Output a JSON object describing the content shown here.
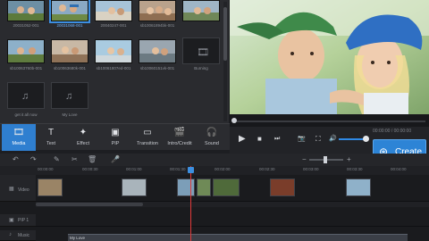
{
  "library": {
    "row1": [
      {
        "caption": "20031052-001",
        "selected": false
      },
      {
        "caption": "20031068-001",
        "selected": true
      },
      {
        "caption": "20040247-001",
        "selected": false
      },
      {
        "caption": "sb10061894bk-001",
        "selected": false
      }
    ],
    "row2": [
      {
        "caption": "sb10063760b-001",
        "selected": false
      },
      {
        "caption": "sb10063680k-001",
        "selected": false
      },
      {
        "caption": "sb10061807ed-001",
        "selected": false
      },
      {
        "caption": "sb10060151vk-001",
        "selected": false
      },
      {
        "caption": "Burning",
        "selected": false
      }
    ],
    "row3": [
      {
        "caption": "get it all now",
        "icon": "music-note-icon"
      },
      {
        "caption": "My Love",
        "icon": "music-note-icon"
      }
    ]
  },
  "preview": {
    "time": "00:00:00 / 00:00:00",
    "controls": {
      "play": "▶",
      "stop": "■",
      "next_frame": "⏭",
      "snapshot": "📷",
      "fullscreen": "⛶",
      "volume": "🔊"
    }
  },
  "create_button": {
    "label": "Create",
    "icon": "film-reel-icon"
  },
  "tabs": [
    {
      "label": "Media",
      "icon": "media-icon",
      "glyph": "🎞",
      "active": true
    },
    {
      "label": "Text",
      "icon": "text-icon",
      "glyph": "T",
      "active": false
    },
    {
      "label": "Effect",
      "icon": "effect-icon",
      "glyph": "✦",
      "active": false
    },
    {
      "label": "PIP",
      "icon": "pip-icon",
      "glyph": "▣",
      "active": false
    },
    {
      "label": "Transition",
      "icon": "transition-icon",
      "glyph": "▭",
      "active": false
    },
    {
      "label": "Intro/Credit",
      "icon": "intro-credit-icon",
      "glyph": "🎬",
      "active": false
    },
    {
      "label": "Sound",
      "icon": "sound-icon",
      "glyph": "🎧",
      "active": false
    }
  ],
  "timeline": {
    "ruler_labels": [
      "00:00:00",
      "00:00:30",
      "00:01:00",
      "00:01:30",
      "00:02:00",
      "00:02:30",
      "00:03:00",
      "00:03:30",
      "00:04:00"
    ],
    "tracks": [
      {
        "name": "Video",
        "icon": "video-track-icon"
      },
      {
        "name": "PIP 1",
        "icon": "pip-track-icon"
      },
      {
        "name": "Music",
        "icon": "music-track-icon"
      }
    ],
    "music_clip": "My Love"
  }
}
